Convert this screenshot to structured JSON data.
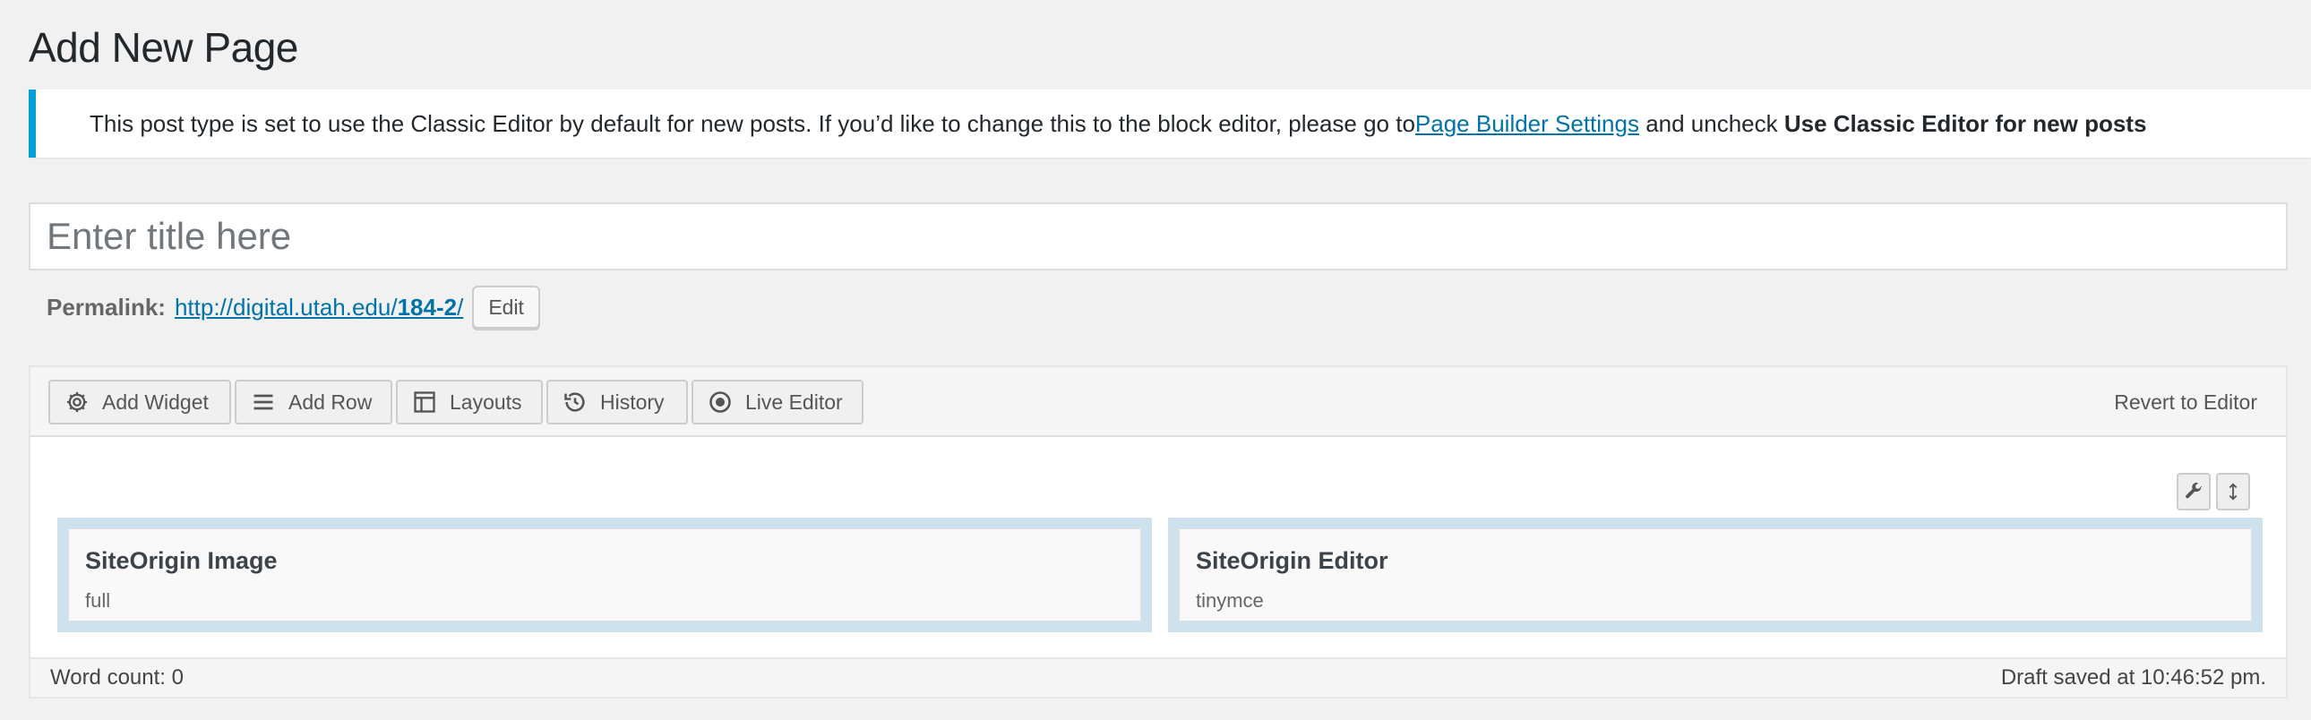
{
  "page": {
    "title": "Add New Page"
  },
  "notice": {
    "text_before": "This post type is set to use the Classic Editor by default for new posts. If you’d like to change this to the block editor, please go to ",
    "link_label": "Page Builder Settings",
    "text_middle": " and uncheck ",
    "bold_text": "Use Classic Editor for new posts",
    "accent_color": "#00a0d2"
  },
  "title_field": {
    "placeholder": "Enter title here",
    "value": ""
  },
  "permalink": {
    "label": "Permalink:",
    "url_prefix": "http://digital.utah.edu/",
    "url_slug": "184-2",
    "url_suffix": "/",
    "edit_label": "Edit"
  },
  "toolbar": {
    "buttons": [
      {
        "label": "Add Widget",
        "icon": "gear-icon"
      },
      {
        "label": "Add Row",
        "icon": "menu-lines-icon"
      },
      {
        "label": "Layouts",
        "icon": "layout-icon"
      },
      {
        "label": "History",
        "icon": "history-icon"
      },
      {
        "label": "Live Editor",
        "icon": "eye-icon"
      }
    ],
    "revert_label": "Revert to Editor"
  },
  "row": {
    "tools": [
      {
        "icon": "wrench-icon"
      },
      {
        "icon": "move-vertical-icon"
      }
    ],
    "cell_color": "#cde2ec",
    "widgets": [
      {
        "title": "SiteOrigin Image",
        "description": "full"
      },
      {
        "title": "SiteOrigin Editor",
        "description": "tinymce"
      }
    ]
  },
  "status": {
    "word_count": "Word count: 0",
    "draft_saved": "Draft saved at 10:46:52 pm."
  }
}
